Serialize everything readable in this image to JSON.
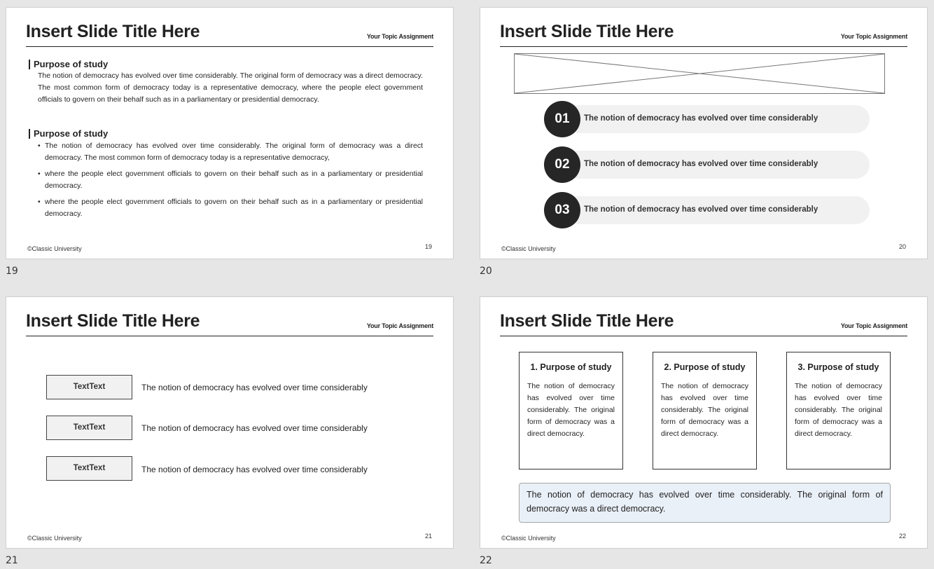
{
  "slides": [
    {
      "number_label": "19",
      "title": "Insert Slide Title Here",
      "topic": "Your Topic Assignment",
      "footer": "©Classic University",
      "page": "19",
      "section1": {
        "heading": "Purpose of study",
        "text": "The notion of democracy has evolved over time considerably. The original form of democracy was a direct democracy. The most common form of democracy today is a representative democracy, where the people elect government officials to govern on their behalf such as in a parliamentary or presidential democracy."
      },
      "section2": {
        "heading": "Purpose of study",
        "bullets": [
          "The notion of democracy has evolved over time considerably. The original form of democracy was a direct democracy. The most common form of democracy today is a representative democracy,",
          "where the people elect government officials to govern on their behalf such as in a parliamentary or presidential democracy.",
          "where the people elect government officials to govern on their behalf such as in a parliamentary or presidential democracy."
        ]
      }
    },
    {
      "number_label": "20",
      "title": "Insert Slide Title Here",
      "topic": "Your Topic Assignment",
      "footer": "©Classic University",
      "page": "20",
      "items": [
        {
          "num": "01",
          "text": "The notion of democracy has evolved over time considerably"
        },
        {
          "num": "02",
          "text": "The notion of democracy has evolved over time considerably"
        },
        {
          "num": "03",
          "text": "The notion of democracy has evolved over time considerably"
        }
      ]
    },
    {
      "number_label": "21",
      "title": "Insert Slide Title Here",
      "topic": "Your Topic Assignment",
      "footer": "©Classic University",
      "page": "21",
      "rows": [
        {
          "box": "TextText",
          "text": "The notion of democracy has evolved over time considerably"
        },
        {
          "box": "TextText",
          "text": "The notion of democracy has evolved over time considerably"
        },
        {
          "box": "TextText",
          "text": "The notion of democracy has evolved over time considerably"
        }
      ]
    },
    {
      "number_label": "22",
      "title": "Insert Slide Title Here",
      "topic": "Your Topic Assignment",
      "footer": "©Classic University",
      "page": "22",
      "cards": [
        {
          "title": "1. Purpose of study",
          "text": "The notion of democracy has evolved over time considerably. The original form of democracy was a direct democracy."
        },
        {
          "title": "2. Purpose of study",
          "text": "The notion of democracy has evolved over time considerably. The original form of democracy was a direct democracy."
        },
        {
          "title": "3. Purpose of study",
          "text": "The notion of democracy has evolved over time considerably. The original form of democracy was a direct democracy."
        }
      ],
      "summary": "The notion of democracy has evolved over time considerably. The original form of democracy was a direct democracy."
    }
  ],
  "colors": {
    "background": "#e6e6e6",
    "slide": "#ffffff",
    "dark": "#262626",
    "pill": "#f1f1f1",
    "summary_box": "#eaf0f8"
  },
  "icons": [
    "image-placeholder-icon"
  ]
}
